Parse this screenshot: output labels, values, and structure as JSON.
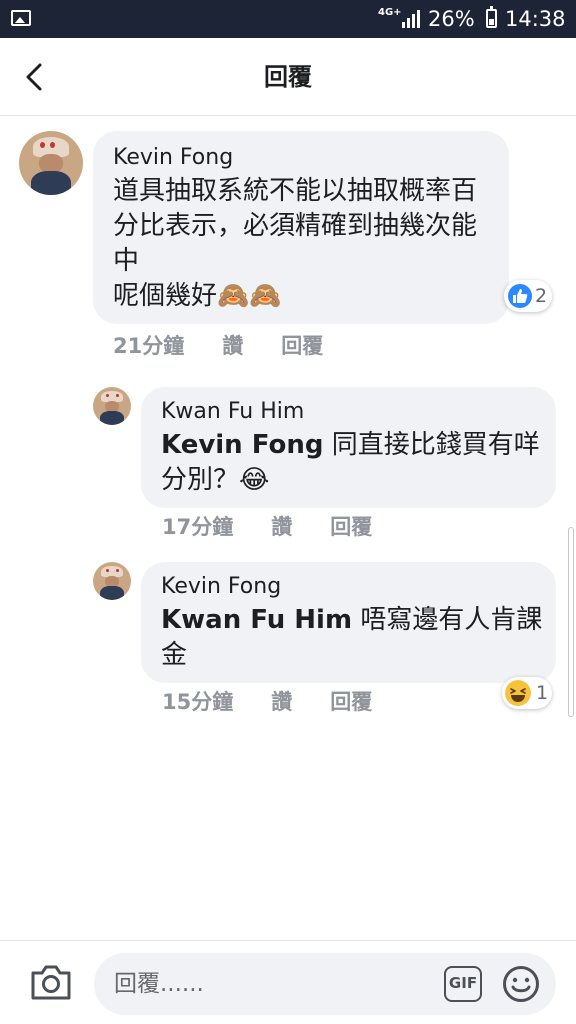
{
  "status_bar": {
    "network": "4G+",
    "battery": "26%",
    "time": "14:38"
  },
  "header": {
    "title": "回覆"
  },
  "comments": [
    {
      "author": "Kevin Fong",
      "text": "道具抽取系統不能以抽取概率百\n分比表示，必須精確到抽幾次能\n中\n呢個幾好🙈🙈",
      "time": "21分鐘",
      "like_label": "讚",
      "reply_label": "回覆",
      "reaction_type": "like",
      "reaction_count": "2"
    },
    {
      "author": "Kwan Fu Him",
      "mention": "Kevin Fong",
      "text": " 同直接比錢買有咩\n分別？😂",
      "time": "17分鐘",
      "like_label": "讚",
      "reply_label": "回覆"
    },
    {
      "author": "Kevin Fong",
      "mention": "Kwan Fu Him",
      "text": " 唔寫邊有人肯課\n金",
      "time": "15分鐘",
      "like_label": "讚",
      "reply_label": "回覆",
      "reaction_type": "haha",
      "reaction_count": "1"
    }
  ],
  "composer": {
    "placeholder": "回覆......",
    "gif_label": "GIF"
  },
  "colors": {
    "status_bar": "#1d2436",
    "bubble": "#f0f2f5",
    "meta_text": "#90949c",
    "like_blue": "#2d88ff",
    "haha_yellow": "#f7c33c"
  },
  "icons": [
    "image-icon",
    "signal-icon",
    "battery-icon",
    "back-icon",
    "like-icon",
    "haha-icon",
    "camera-icon",
    "gif-icon",
    "emoji-icon"
  ]
}
